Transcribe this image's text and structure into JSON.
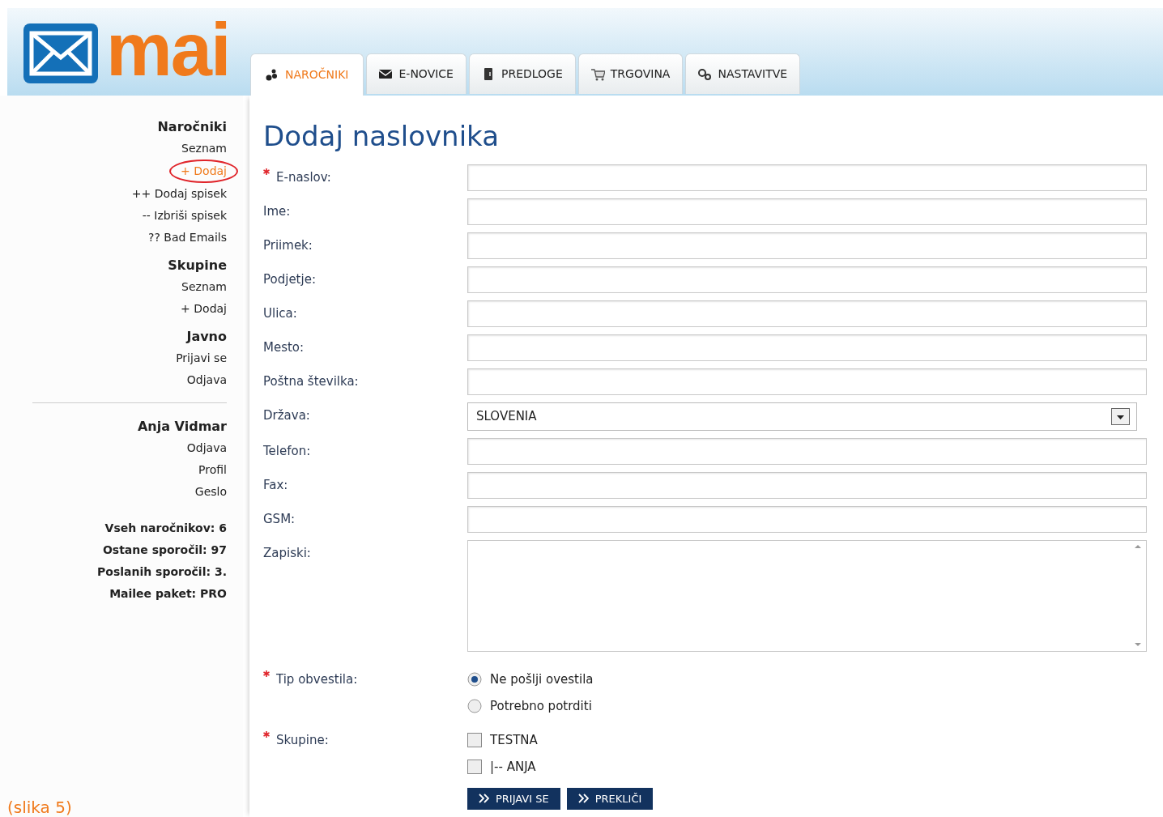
{
  "header": {
    "logo_text": "mai"
  },
  "tabs": [
    {
      "label": "NAROČNIKI",
      "selected": true
    },
    {
      "label": "E-NOVICE",
      "selected": false
    },
    {
      "label": "PREDLOGE",
      "selected": false
    },
    {
      "label": "TRGOVINA",
      "selected": false
    },
    {
      "label": "NASTAVITVE",
      "selected": false
    }
  ],
  "sidebar": {
    "sections": [
      {
        "heading": "Naročniki",
        "items": [
          {
            "label": "Seznam",
            "selected": false
          },
          {
            "label": "+ Dodaj",
            "selected": true
          },
          {
            "label": "++ Dodaj spisek",
            "selected": false
          },
          {
            "label": "-- Izbriši spisek",
            "selected": false
          },
          {
            "label": "?? Bad Emails",
            "selected": false
          }
        ]
      },
      {
        "heading": "Skupine",
        "items": [
          {
            "label": "Seznam",
            "selected": false
          },
          {
            "label": "+ Dodaj",
            "selected": false
          }
        ]
      },
      {
        "heading": "Javno",
        "items": [
          {
            "label": "Prijavi se",
            "selected": false
          },
          {
            "label": "Odjava",
            "selected": false
          }
        ]
      },
      {
        "heading": "Anja Vidmar",
        "divider_above": true,
        "items": [
          {
            "label": "Odjava",
            "selected": false
          },
          {
            "label": "Profil",
            "selected": false
          },
          {
            "label": "Geslo",
            "selected": false
          }
        ]
      }
    ],
    "stats": [
      "Vseh naročnikov: 6",
      "Ostane sporočil: 97",
      "Poslanih sporočil: 3.",
      "Mailee paket: PRO"
    ]
  },
  "form": {
    "title": "Dodaj naslovnika",
    "fields": [
      {
        "kind": "text",
        "label": "E-naslov:",
        "required": true
      },
      {
        "kind": "text",
        "label": "Ime:",
        "required": false
      },
      {
        "kind": "text",
        "label": "Priimek:",
        "required": false
      },
      {
        "kind": "text",
        "label": "Podjetje:",
        "required": false
      },
      {
        "kind": "text",
        "label": "Ulica:",
        "required": false
      },
      {
        "kind": "text",
        "label": "Mesto:",
        "required": false
      },
      {
        "kind": "text",
        "label": "Poštna številka:",
        "required": false
      },
      {
        "kind": "select",
        "label": "Država:",
        "required": false,
        "value": "SLOVENIA"
      },
      {
        "kind": "text",
        "label": "Telefon:",
        "required": false
      },
      {
        "kind": "text",
        "label": "Fax:",
        "required": false
      },
      {
        "kind": "text",
        "label": "GSM:",
        "required": false
      },
      {
        "kind": "textarea",
        "label": "Zapiski:",
        "required": false
      }
    ],
    "notify": {
      "label": "Tip obvestila:",
      "required": true,
      "options": [
        {
          "label": "Ne pošlji ovestila",
          "selected": true
        },
        {
          "label": "Potrebno potrditi",
          "selected": false
        }
      ]
    },
    "groups": {
      "label": "Skupine:",
      "required": true,
      "options": [
        {
          "label": "TESTNA",
          "checked": false
        },
        {
          "label": "|-- ANJA",
          "checked": false
        }
      ]
    },
    "buttons": [
      "PRIJAVI SE",
      "PREKLIČI"
    ]
  },
  "caption": "(slika 5)"
}
